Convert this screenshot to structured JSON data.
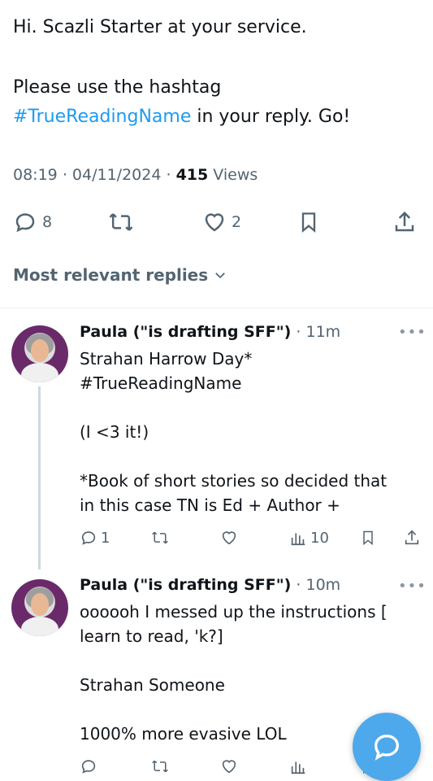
{
  "tweet": {
    "line1": "Hi. Scazli Starter at your service.",
    "line2_prefix": "Please use the hashtag",
    "hashtag": "#TrueReadingName",
    "line3_suffix": " in your reply. Go!",
    "time": "08:19",
    "date": "04/11/2024",
    "views_count": "415",
    "views_label": " Views",
    "replies": "8",
    "likes": "2"
  },
  "sort_label": "Most relevant replies",
  "replies": [
    {
      "name": "Paula (\"is drafting SFF\")",
      "time": "· 11m",
      "lines": [
        "Strahan Harrow Day*"
      ],
      "hashtag": "#TrueReadingName",
      "line_after_1": "(I <3 it!)",
      "line_after_2": "*Book of short stories so decided that",
      "line_after_3": "in this case TN is Ed + Author +",
      "reply_count": "1",
      "views": "10"
    },
    {
      "name": "Paula (\"is drafting SFF\")",
      "time": "· 10m",
      "line1": "oooooh I messed up the instructions [",
      "line2": "learn to read, 'k?]",
      "line3": "Strahan Someone",
      "line4": "1000% more evasive LOL"
    }
  ],
  "colors": {
    "accent": "#1d9bf0",
    "secondary_text": "#536471",
    "fab": "#4da9eb"
  },
  "icons": [
    "reply-icon",
    "retweet-icon",
    "like-icon",
    "bookmark-icon",
    "share-icon",
    "more-icon",
    "views-icon",
    "chevron-down-icon",
    "compose-icon"
  ]
}
